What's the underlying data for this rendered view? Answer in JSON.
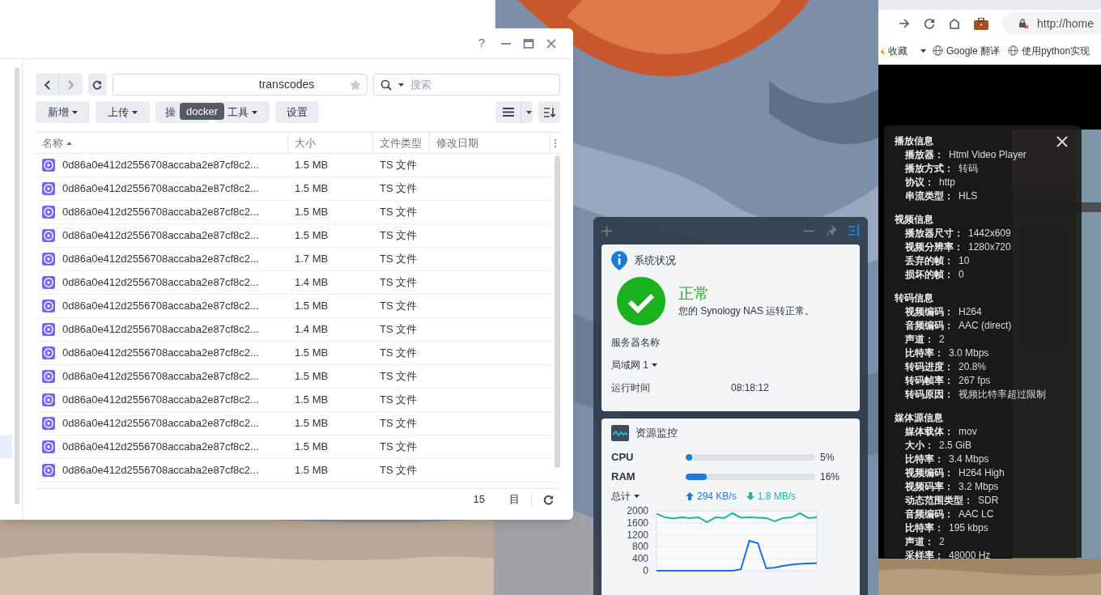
{
  "file_window": {
    "help": "?",
    "path": "transcodes",
    "search": {
      "placeholder": "搜索"
    },
    "toolbar": [
      {
        "label": "新增",
        "dropdown": true
      },
      {
        "label": "上传",
        "dropdown": true
      },
      {
        "label": "操"
      },
      {
        "label": "工具",
        "dropdown": true
      },
      {
        "label": "设置",
        "dropdown": false
      }
    ],
    "tooltip": "docker",
    "columns": [
      {
        "label": "名称",
        "sorted": true
      },
      {
        "label": "大小",
        "sorted": false
      },
      {
        "label": "文件类型",
        "sorted": false
      },
      {
        "label": "修改日期",
        "sorted": false
      }
    ],
    "rows": [
      {
        "name": "0d86a0e412d2556708accaba2e87cf8c2...",
        "size": "1.5 MB",
        "type": "TS 文件"
      },
      {
        "name": "0d86a0e412d2556708accaba2e87cf8c2...",
        "size": "1.5 MB",
        "type": "TS 文件"
      },
      {
        "name": "0d86a0e412d2556708accaba2e87cf8c2...",
        "size": "1.5 MB",
        "type": "TS 文件"
      },
      {
        "name": "0d86a0e412d2556708accaba2e87cf8c2...",
        "size": "1.5 MB",
        "type": "TS 文件"
      },
      {
        "name": "0d86a0e412d2556708accaba2e87cf8c2...",
        "size": "1.7 MB",
        "type": "TS 文件"
      },
      {
        "name": "0d86a0e412d2556708accaba2e87cf8c2...",
        "size": "1.4 MB",
        "type": "TS 文件"
      },
      {
        "name": "0d86a0e412d2556708accaba2e87cf8c2...",
        "size": "1.5 MB",
        "type": "TS 文件"
      },
      {
        "name": "0d86a0e412d2556708accaba2e87cf8c2...",
        "size": "1.4 MB",
        "type": "TS 文件"
      },
      {
        "name": "0d86a0e412d2556708accaba2e87cf8c2...",
        "size": "1.5 MB",
        "type": "TS 文件"
      },
      {
        "name": "0d86a0e412d2556708accaba2e87cf8c2...",
        "size": "1.5 MB",
        "type": "TS 文件"
      },
      {
        "name": "0d86a0e412d2556708accaba2e87cf8c2...",
        "size": "1.5 MB",
        "type": "TS 文件"
      },
      {
        "name": "0d86a0e412d2556708accaba2e87cf8c2...",
        "size": "1.5 MB",
        "type": "TS 文件"
      },
      {
        "name": "0d86a0e412d2556708accaba2e87cf8c2...",
        "size": "1.5 MB",
        "type": "TS 文件"
      },
      {
        "name": "0d86a0e412d2556708accaba2e87cf8c2...",
        "size": "1.5 MB",
        "type": "TS 文件"
      }
    ],
    "footer": {
      "count": "15",
      "label": "目"
    }
  },
  "widgets": {
    "system_status": {
      "title": "系统状况",
      "status": "正常",
      "message": "您的 Synology NAS 运转正常。",
      "fields": [
        {
          "label": "服务器名称",
          "dropdown": false
        },
        {
          "label": "局域网 1",
          "dropdown": true
        },
        {
          "label": "运行时间",
          "dropdown": false,
          "value": "08:18:12"
        }
      ]
    },
    "resource_monitor": {
      "title": "资源监控",
      "meters": [
        {
          "label": "CPU",
          "level": 0.05,
          "reading": "5%"
        },
        {
          "label": "RAM",
          "level": 0.16,
          "reading": "16%"
        }
      ],
      "network": {
        "label": "总计",
        "upload": "294 KB/s",
        "download": "1.8 MB/s"
      },
      "chart_data": {
        "type": "line",
        "grid": true,
        "ylim": [
          0,
          2000
        ],
        "yticks": [
          0,
          400,
          800,
          1200,
          1600,
          2000
        ],
        "series": [
          {
            "color": "#1fb3a8",
            "values": [
              1900,
              1780,
              1740,
              1780,
              1760,
              1780,
              1620,
              1780,
              1760,
              1920,
              1770,
              1780,
              1770,
              1760,
              1650,
              1760,
              1780,
              1920,
              1760,
              1780
            ]
          },
          {
            "color": "#1a6fe0",
            "values": [
              0,
              0,
              0,
              0,
              0,
              0,
              0,
              0,
              0,
              0,
              50,
              1000,
              920,
              80,
              100,
              160,
              200,
              230,
              240,
              250
            ]
          }
        ]
      }
    }
  },
  "browser": {
    "url": "http://home",
    "bookmarks": [
      {
        "label": "收藏",
        "kind": "folder"
      },
      {
        "label": "Google 翻译",
        "kind": "link"
      },
      {
        "label": "使用python实现",
        "kind": "link"
      }
    ],
    "player_info": [
      {
        "title": "播放信息",
        "rows": [
          {
            "label": "播放器：",
            "value": "Html Video Player"
          },
          {
            "label": "播放方式：",
            "value": "转码"
          },
          {
            "label": "协议：",
            "value": "http"
          },
          {
            "label": "串流类型：",
            "value": "HLS"
          }
        ]
      },
      {
        "title": "视频信息",
        "rows": [
          {
            "label": "播放器尺寸：",
            "value": "1442x609"
          },
          {
            "label": "视频分辨率：",
            "value": "1280x720"
          },
          {
            "label": "丢弃的帧：",
            "value": "10"
          },
          {
            "label": "损坏的帧：",
            "value": "0"
          }
        ]
      },
      {
        "title": "转码信息",
        "rows": [
          {
            "label": "视频编码：",
            "value": "H264"
          },
          {
            "label": "音频编码：",
            "value": "AAC (direct)"
          },
          {
            "label": "声道：",
            "value": "2"
          },
          {
            "label": "比特率：",
            "value": "3.0 Mbps"
          },
          {
            "label": "转码进度：",
            "value": "20.8%"
          },
          {
            "label": "转码帧率：",
            "value": "267 fps"
          },
          {
            "label": "转码原因：",
            "value": "视频比特率超过限制"
          }
        ]
      },
      {
        "title": "媒体源信息",
        "rows": [
          {
            "label": "媒体载体：",
            "value": "mov"
          },
          {
            "label": "大小：",
            "value": "2.5 GiB"
          },
          {
            "label": "比特率：",
            "value": "3.4 Mbps"
          },
          {
            "label": "视频编码：",
            "value": "H264 High"
          },
          {
            "label": "视频码率：",
            "value": "3.2 Mbps"
          },
          {
            "label": "动态范围类型：",
            "value": "SDR"
          },
          {
            "label": "音频编码：",
            "value": "AAC LC"
          },
          {
            "label": "比特率：",
            "value": "195 kbps"
          },
          {
            "label": "声道：",
            "value": "2"
          },
          {
            "label": "采样率：",
            "value": "48000 Hz"
          }
        ]
      }
    ]
  }
}
